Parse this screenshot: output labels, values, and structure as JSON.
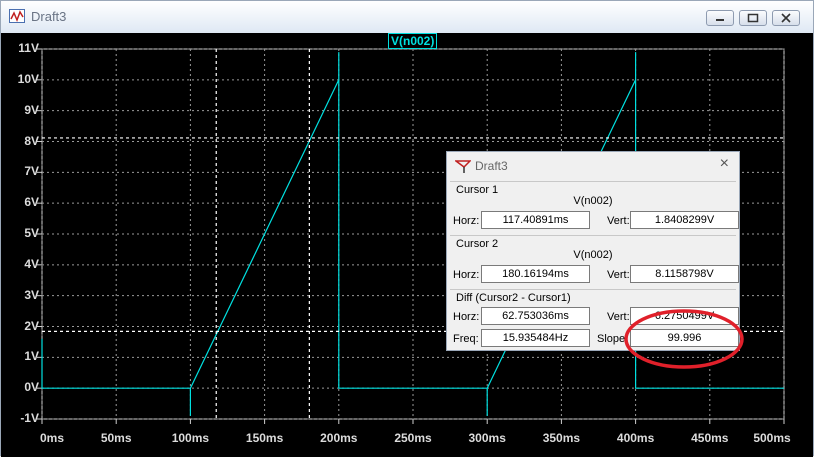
{
  "window": {
    "title": "Draft3",
    "buttons": {
      "minimize": "minimize",
      "restore": "restore",
      "close": "close"
    }
  },
  "plot": {
    "trace_label": "V(n002)",
    "y_ticks": [
      "11V",
      "10V",
      "9V",
      "8V",
      "7V",
      "6V",
      "5V",
      "4V",
      "3V",
      "2V",
      "1V",
      "0V",
      "-1V"
    ],
    "x_ticks": [
      "0ms",
      "50ms",
      "100ms",
      "150ms",
      "200ms",
      "250ms",
      "300ms",
      "350ms",
      "400ms",
      "450ms",
      "500ms"
    ],
    "trace_color": "#00e0e0"
  },
  "chart_data": {
    "type": "line",
    "title": "",
    "xlabel": "",
    "ylabel": "",
    "xlim": [
      0,
      500
    ],
    "ylim": [
      -1,
      11
    ],
    "series": [
      {
        "name": "V(n002)",
        "x": [
          0,
          0,
          100,
          100,
          100,
          200,
          200,
          200,
          300,
          300,
          300,
          400,
          400,
          400,
          500
        ],
        "y": [
          1.6,
          0,
          0,
          -0.9,
          0,
          10.0,
          10.9,
          0,
          0,
          -0.9,
          0,
          10.0,
          10.9,
          0,
          0
        ]
      }
    ],
    "cursors": {
      "cursor1_x": 117.40891,
      "cursor1_y": 1.8408299,
      "cursor2_x": 180.16194,
      "cursor2_y": 8.1158798
    },
    "grid": true
  },
  "cursor_dialog": {
    "title": "Draft3",
    "cursor1": {
      "group": "Cursor 1",
      "trace": "V(n002)",
      "horz_label": "Horz:",
      "horz": "117.40891ms",
      "vert_label": "Vert:",
      "vert": "1.8408299V"
    },
    "cursor2": {
      "group": "Cursor 2",
      "trace": "V(n002)",
      "horz_label": "Horz:",
      "horz": "180.16194ms",
      "vert_label": "Vert:",
      "vert": "8.1158798V"
    },
    "diff": {
      "group": "Diff (Cursor2 - Cursor1)",
      "horz_label": "Horz:",
      "horz": "62.753036ms",
      "vert_label": "Vert:",
      "vert": "6.2750499V",
      "freq_label": "Freq:",
      "freq": "15.935484Hz",
      "slope_label": "Slope:",
      "slope": "99.996"
    }
  },
  "annotation": {
    "color": "#e0202a"
  }
}
